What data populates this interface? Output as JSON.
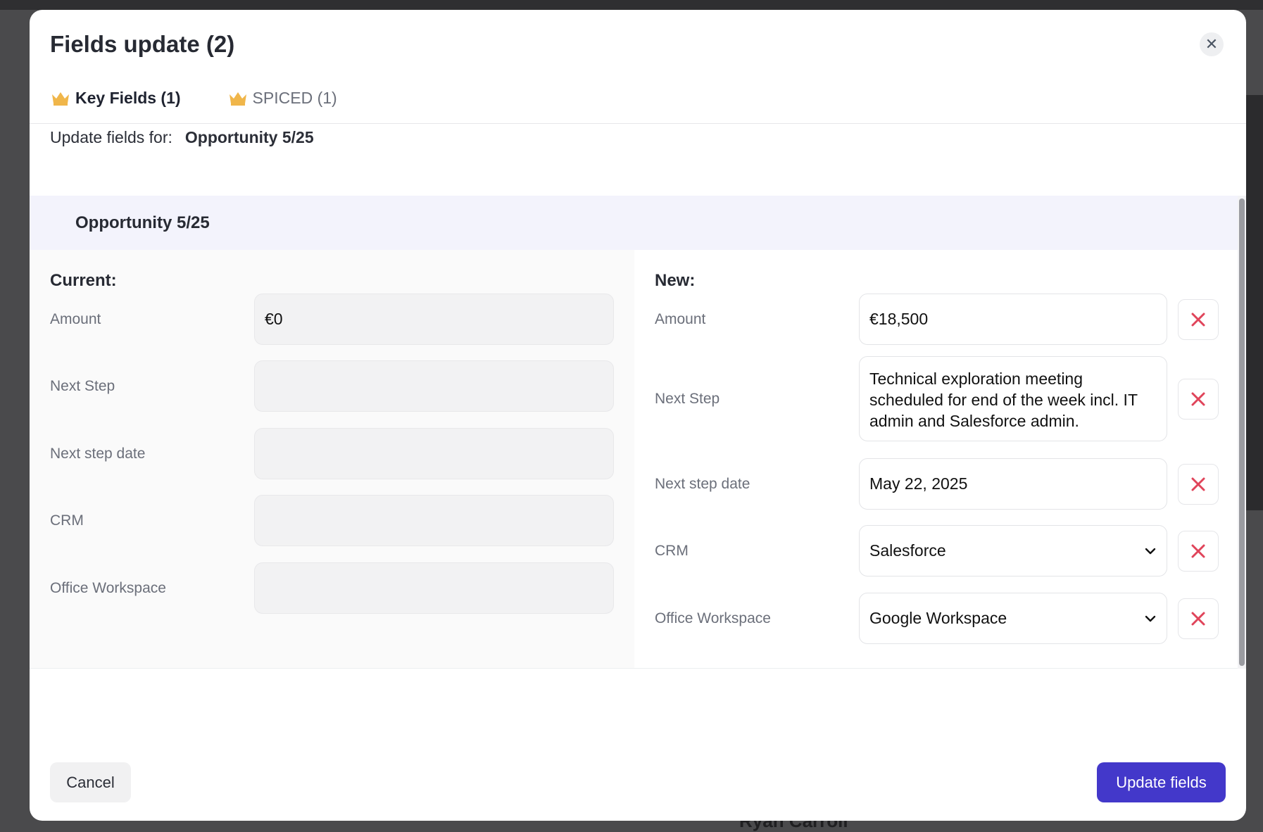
{
  "modal": {
    "title": "Fields update (2)",
    "close_icon": "close-icon"
  },
  "tabs": [
    {
      "label": "Key Fields (1)",
      "icon": "crown-icon",
      "active": true
    },
    {
      "label": "SPICED (1)",
      "icon": "crown-icon",
      "active": false
    }
  ],
  "update_for": {
    "label": "Update fields for:",
    "value": "Opportunity 5/25"
  },
  "section": {
    "title": "Opportunity 5/25"
  },
  "current": {
    "title": "Current:",
    "fields": [
      {
        "label": "Amount",
        "value": "€0"
      },
      {
        "label": "Next Step",
        "value": ""
      },
      {
        "label": "Next step date",
        "value": ""
      },
      {
        "label": "CRM",
        "value": ""
      },
      {
        "label": "Office Workspace",
        "value": ""
      }
    ]
  },
  "new": {
    "title": "New:",
    "fields": [
      {
        "label": "Amount",
        "value": "€18,500"
      },
      {
        "label": "Next Step",
        "value": "Technical exploration meeting scheduled for end of the week incl. IT admin and Salesforce admin."
      },
      {
        "label": "Next step date",
        "value": "May 22, 2025"
      },
      {
        "label": "CRM",
        "value": "Salesforce",
        "type": "select"
      },
      {
        "label": "Office Workspace",
        "value": "Google Workspace",
        "type": "select"
      }
    ]
  },
  "footer": {
    "cancel_label": "Cancel",
    "update_label": "Update fields"
  },
  "background": {
    "name": "Ryan Carroll"
  },
  "colors": {
    "primary": "#4338ca",
    "remove": "#e0445a",
    "crown": "#f0b64a",
    "section_bg": "#f3f3fc"
  }
}
